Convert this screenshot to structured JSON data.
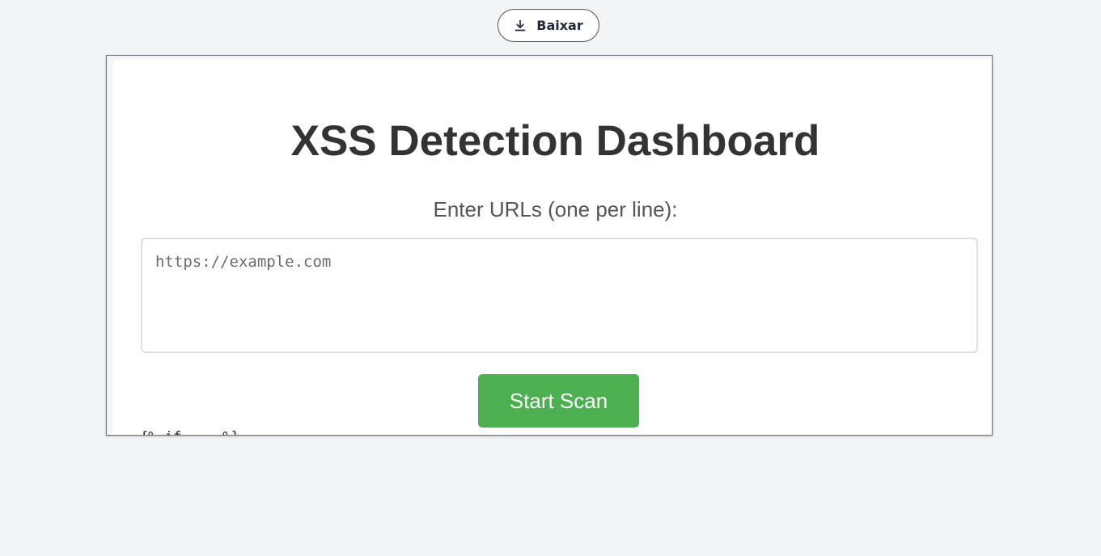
{
  "toolbar": {
    "download_label": "Baixar",
    "download_icon": "download-icon"
  },
  "dashboard": {
    "title": "XSS Detection Dashboard",
    "url_label": "Enter URLs (one per line):",
    "url_placeholder": "https://example.com",
    "url_value": "",
    "scan_button": "Start Scan",
    "template_fragment": "{% if ... %}"
  },
  "colors": {
    "page_background": "#f3f4f6",
    "scan_button": "#4caf50",
    "title_text": "#333333"
  }
}
